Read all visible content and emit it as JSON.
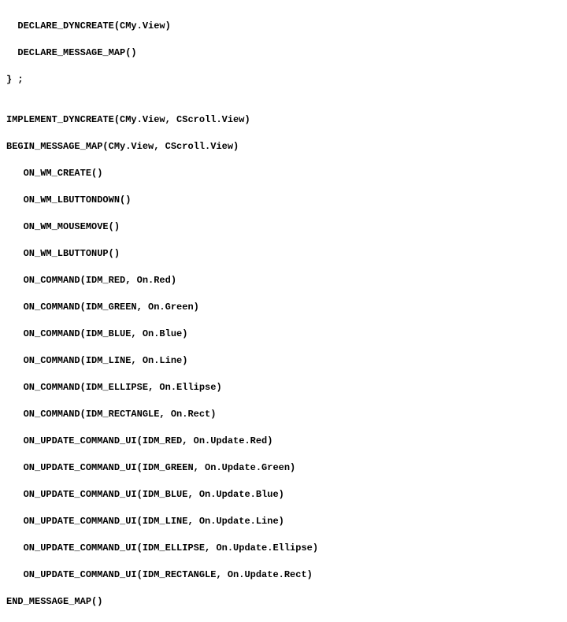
{
  "code": {
    "lines": [
      "  DECLARE_DYNCREATE(CMy.View)",
      "  DECLARE_MESSAGE_MAP()",
      "} ;",
      "",
      "IMPLEMENT_DYNCREATE(CMy.View, CScroll.View)",
      "BEGIN_MESSAGE_MAP(CMy.View, CScroll.View)",
      "   ON_WM_CREATE()",
      "   ON_WM_LBUTTONDOWN()",
      "   ON_WM_MOUSEMOVE()",
      "   ON_WM_LBUTTONUP()",
      "   ON_COMMAND(IDM_RED, On.Red)",
      "   ON_COMMAND(IDM_GREEN, On.Green)",
      "   ON_COMMAND(IDM_BLUE, On.Blue)",
      "   ON_COMMAND(IDM_LINE, On.Line)",
      "   ON_COMMAND(IDM_ELLIPSE, On.Ellipse)",
      "   ON_COMMAND(IDM_RECTANGLE, On.Rect)",
      "   ON_UPDATE_COMMAND_UI(IDM_RED, On.Update.Red)",
      "   ON_UPDATE_COMMAND_UI(IDM_GREEN, On.Update.Green)",
      "   ON_UPDATE_COMMAND_UI(IDM_BLUE, On.Update.Blue)",
      "   ON_UPDATE_COMMAND_UI(IDM_LINE, On.Update.Line)",
      "   ON_UPDATE_COMMAND_UI(IDM_ELLIPSE, On.Update.Ellipse)",
      "   ON_UPDATE_COMMAND_UI(IDM_RECTANGLE, On.Update.Rect)",
      "END_MESSAGE_MAP()"
    ]
  }
}
